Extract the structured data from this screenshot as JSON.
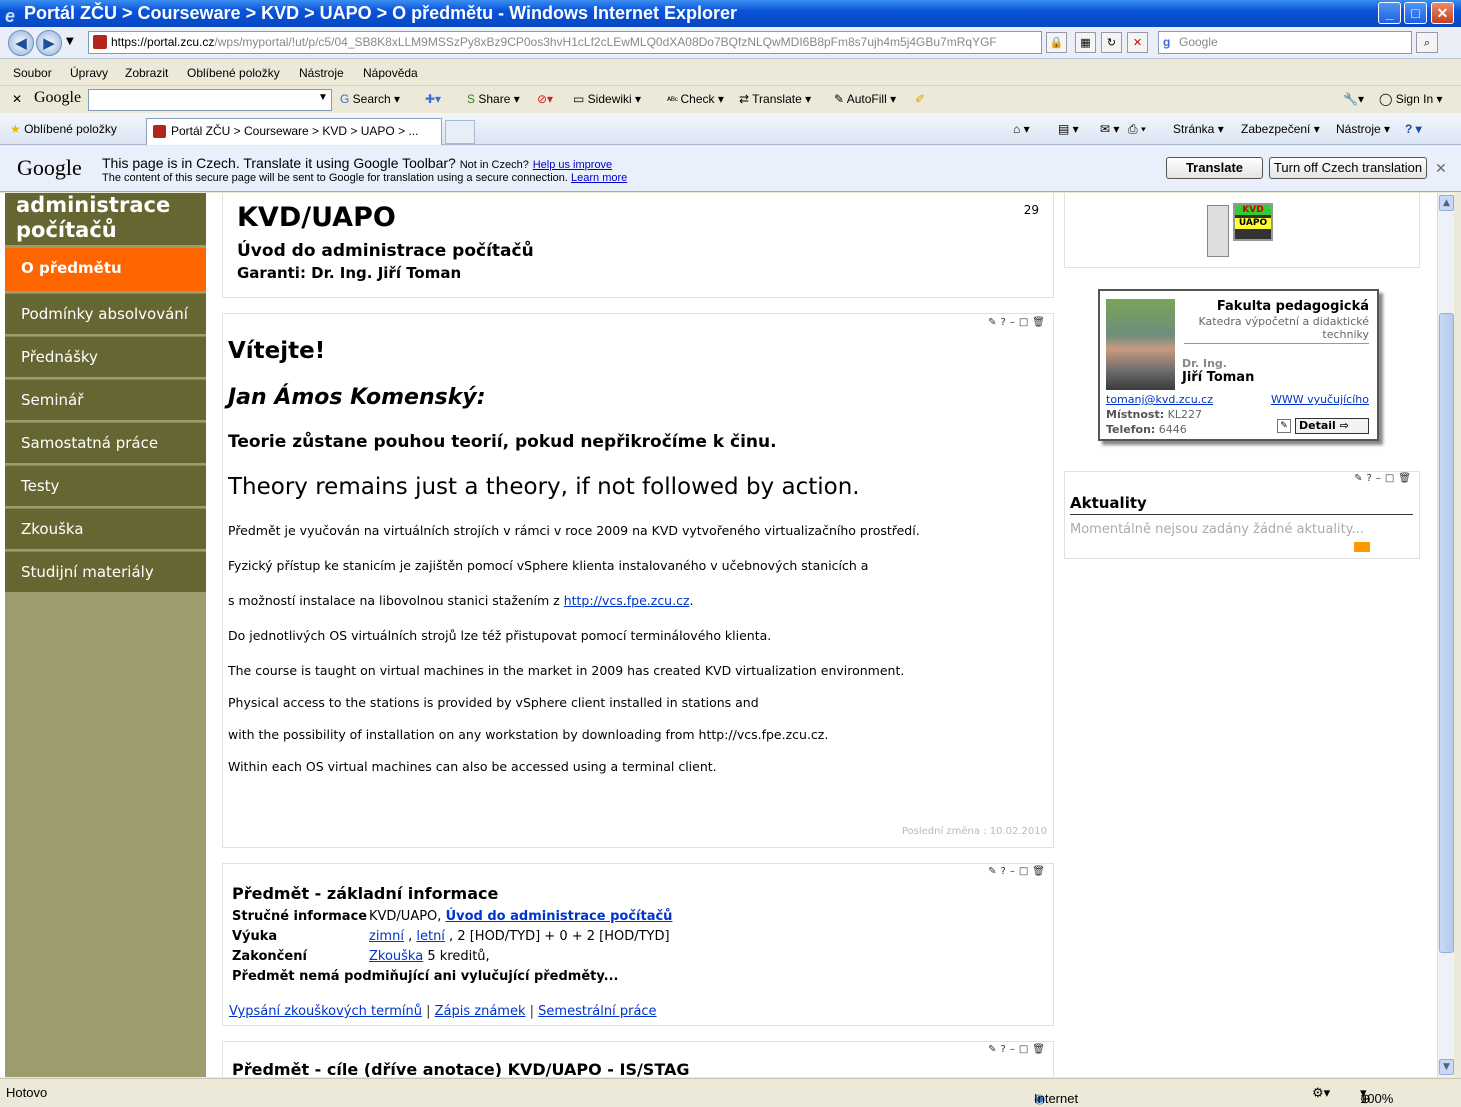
{
  "window": {
    "title": "Portál ZČU > Courseware > KVD > UAPO > O předmětu - Windows Internet Explorer",
    "minimize": "_",
    "maximize": "□",
    "close": "✕"
  },
  "address_bar": {
    "scheme": "https://",
    "host": "portal.zcu.cz",
    "path": "/wps/myportal/!ut/p/c5/04_SB8K8xLLM9MSSzPy8xBz9CP0os3hvH1cLf2cLEwMLQ0dXA08Do7BQfzNLQwMDI6B8pFm8s7ujh4m5j4GBu7mRqYGF",
    "search_placeholder": "Google"
  },
  "menu": [
    "Soubor",
    "Úpravy",
    "Zobrazit",
    "Oblíbené položky",
    "Nástroje",
    "Nápověda"
  ],
  "google_toolbar": {
    "logo": "Google",
    "search_label": "Search",
    "share_label": "Share",
    "sidewiki_label": "Sidewiki",
    "check_label": "Check",
    "translate_label": "Translate",
    "autofill_label": "AutoFill",
    "signin_label": "Sign In"
  },
  "tabs": {
    "favorites": "Oblíbené položky",
    "active_tab": "Portál ZČU > Courseware > KVD > UAPO > ...",
    "cmd_page": "Stránka",
    "cmd_security": "Zabezpečení",
    "cmd_tools": "Nástroje"
  },
  "translate_bar": {
    "logo": "Google",
    "message": "This page is in Czech.  Translate it using Google Toolbar?",
    "not_in": "Not in Czech?",
    "help": "Help us improve",
    "secure_note": "The content of this secure page will be sent to Google for translation using a secure connection.",
    "learn_more": "Learn more",
    "translate_button": "Translate",
    "turn_off_button": "Turn off Czech translation",
    "close": "✕"
  },
  "sidebar": {
    "heading_line1": "administrace",
    "heading_line2": "počítačů",
    "items": [
      {
        "label": "O předmětu"
      },
      {
        "label": "Podmínky absolvování"
      },
      {
        "label": "Přednášky"
      },
      {
        "label": "Seminář"
      },
      {
        "label": "Samostatná práce"
      },
      {
        "label": "Testy"
      },
      {
        "label": "Zkouška"
      },
      {
        "label": "Studijní materiály"
      }
    ]
  },
  "course_header": {
    "code": "KVD/UAPO",
    "name": "Úvod do administrace počítačů",
    "guarantor": "Garanti: Dr. Ing. Jiří Toman",
    "counter": "29"
  },
  "portlet_controls": "✎?–□🗑",
  "welcome": {
    "greeting": "Vítejte!",
    "author": "Jan Ámos Komenský:",
    "quote_cz": "Teorie zůstane pouhou teorií, pokud nepřikročíme k činu.",
    "quote_en": "Theory remains just a theory, if not followed by action.",
    "p1": "Předmět je vyučován na virtuálních strojích v rámci v roce 2009 na KVD vytvořeného virtualizačního prostředí.",
    "p2": "Fyzický přístup ke stanicím je zajištěn pomocí vSphere klienta instalovaného v učebnových stanicích a",
    "p3_prefix": "s možností instalace na libovolnou stanici stažením z ",
    "p3_link": "http://vcs.fpe.zcu.cz",
    "p3_suffix": ".",
    "p4": "Do jednotlivých OS virtuálních strojů lze též přistupovat pomocí terminálového klienta.",
    "e1": "The course is taught on virtual machines in the market in 2009 has created KVD virtualization environment.",
    "e2": "Physical access to the stations is provided by vSphere client installed in stations and",
    "e3": "with the possibility of installation on any workstation by downloading from http://vcs.fpe.zcu.cz.",
    "e4": "Within each OS virtual machines can also be accessed using a terminal client.",
    "last_change": "Poslední změna : 10.02.2010"
  },
  "basic_info": {
    "heading": "Předmět - základní informace",
    "short_label": "Stručné informace",
    "short_code": "KVD/UAPO, ",
    "short_link": "Úvod do administrace počítačů",
    "teaching_label": "Výuka",
    "winter": "zimní",
    "sep": " , ",
    "summer": "letní",
    "teaching_rest": " , 2 [HOD/TYD] + 0 + 2 [HOD/TYD]",
    "completion_label": "Zakončení",
    "exam": "Zkouška",
    "credits": " 5 kreditů,",
    "prereq": "Předmět nemá podmiňující ani vylučující předměty...",
    "link_exams": "Vypsání zkouškových termínů",
    "link_grades": "Zápis známek",
    "link_works": "Semestrální práce",
    "pipe": " | "
  },
  "goals": {
    "heading": "Předmět - cíle (dříve anotace) KVD/UAPO - IS/STAG"
  },
  "logo_badge": {
    "top": "KVD",
    "bottom": "UAPO"
  },
  "teacher_card": {
    "faculty": "Fakulta pedagogická",
    "department": "Katedra výpočetní a didaktické techniky",
    "title": "Dr. Ing.",
    "name": "Jiří Toman",
    "email": "tomanj@kvd.zcu.cz",
    "www": "WWW vyučujícího",
    "room_label": "Místnost:",
    "room": " KL227",
    "phone_label": "Telefon:",
    "phone": " 6446",
    "detail": "Detail"
  },
  "news": {
    "heading": "Aktuality",
    "empty": "Momentálně nejsou zadány žádné aktuality..."
  },
  "status_bar": {
    "status": "Hotovo",
    "zone": "Internet",
    "zoom": "100%"
  }
}
